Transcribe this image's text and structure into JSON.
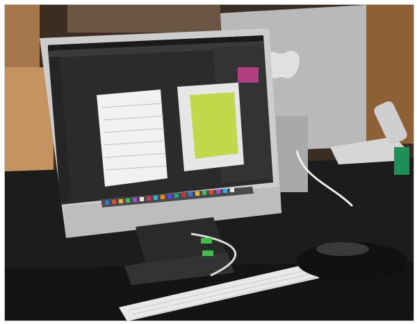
{
  "photo": {
    "subject": "",
    "colors": {
      "desk": "#1b1b1b",
      "floor": "#b9895a",
      "wall": "#3a2a1f",
      "imac_body": "#c9c9c9",
      "screen_bg": "#2a2a2a",
      "artboard": "#f0f0f0",
      "yellow_square": "#c3d74b",
      "keyboard": "#e8e8e8",
      "mouse": "#3a3a3a",
      "phone": "#d8d8d8"
    }
  }
}
